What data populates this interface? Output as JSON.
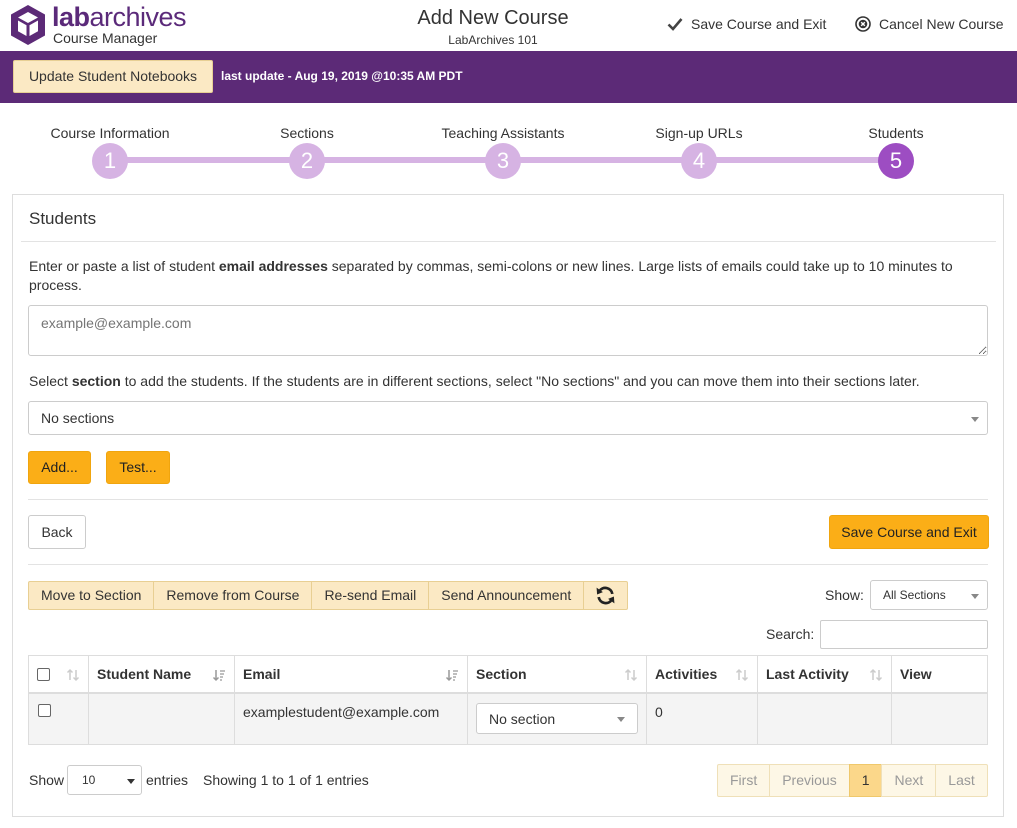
{
  "header": {
    "brand_bold": "lab",
    "brand_rest": "archives",
    "brand_sub": "Course Manager",
    "title": "Add New Course",
    "subtitle": "LabArchives 101",
    "save_exit": "Save Course and Exit",
    "cancel": "Cancel New Course"
  },
  "purplebar": {
    "update_button": "Update Student Notebooks",
    "last_update": "last update - Aug 19, 2019 @10:35 AM PDT"
  },
  "steps": [
    {
      "label": "Course Information",
      "number": "1"
    },
    {
      "label": "Sections",
      "number": "2"
    },
    {
      "label": "Teaching Assistants",
      "number": "3"
    },
    {
      "label": "Sign-up URLs",
      "number": "4"
    },
    {
      "label": "Students",
      "number": "5"
    }
  ],
  "students": {
    "title": "Students",
    "instr_pre": "Enter or paste a list of student ",
    "instr_bold": "email addresses",
    "instr_post": " separated by commas, semi-colons or new lines. Large lists of emails could take up to 10 minutes to process.",
    "email_placeholder": "example@example.com",
    "section_pre": "Select ",
    "section_bold": "section",
    "section_post": " to add the students. If the students are in different sections, select \"No sections\" and you can move them into their sections later.",
    "section_value": "No sections",
    "add_button": "Add...",
    "test_button": "Test...",
    "back_button": "Back",
    "save_button": "Save Course and Exit"
  },
  "toolbar": {
    "move": "Move to Section",
    "remove": "Remove from Course",
    "resend": "Re-send Email",
    "announce": "Send Announcement",
    "show_label": "Show:",
    "show_value": "All Sections",
    "search_label": "Search:"
  },
  "table": {
    "columns": [
      "Student Name",
      "Email",
      "Section",
      "Activities",
      "Last Activity",
      "View"
    ],
    "rows": [
      {
        "name": "",
        "email": "examplestudent@example.com",
        "section": "No section",
        "activities": "0",
        "last_activity": "",
        "view": ""
      }
    ]
  },
  "footer": {
    "show": "Show",
    "page_size": "10",
    "entries": "entries",
    "info": "Showing 1 to 1 of 1 entries",
    "first": "First",
    "previous": "Previous",
    "page": "1",
    "next": "Next",
    "last": "Last"
  },
  "colors": {
    "brand_purple": "#5c2a77",
    "step_active": "#9d4dc2",
    "step_inactive": "#d6b3e3",
    "accent_yellow": "#fbae17"
  }
}
